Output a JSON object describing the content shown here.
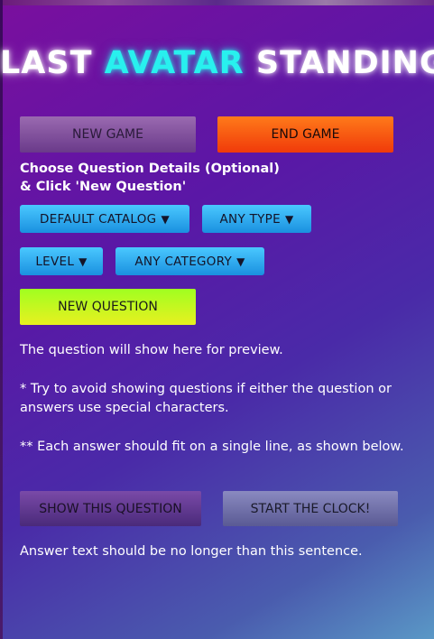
{
  "title": {
    "part1": "LAST",
    "part2": "AVATAR",
    "part3": "STANDING"
  },
  "controls": {
    "new_game_label": "NEW GAME",
    "end_game_label": "END GAME",
    "instructions_line1": "Choose Question Details (Optional)",
    "instructions_line2": "& Click 'New Question'",
    "catalog_label": "DEFAULT CATALOG",
    "type_label": "ANY TYPE",
    "level_label": "LEVEL",
    "category_label": "ANY CATEGORY",
    "dropdown_arrow": "▼",
    "new_question_label": "NEW QUESTION"
  },
  "preview": {
    "placeholder": "The question will show here for preview.",
    "note1": "* Try to avoid showing questions if either the question or answers use special characters.",
    "note2": "** Each answer should fit on a single line, as shown below.",
    "show_question_label": "SHOW THIS QUESTION",
    "start_clock_label": "START THE CLOCK!",
    "answer_sample": "Answer text should be no longer than this sentence."
  },
  "colors": {
    "accent_cyan": "#28f0ee",
    "end_game": "#f04a0a",
    "new_question": "#b8f41a",
    "dropdown": "#2aa8f0"
  }
}
